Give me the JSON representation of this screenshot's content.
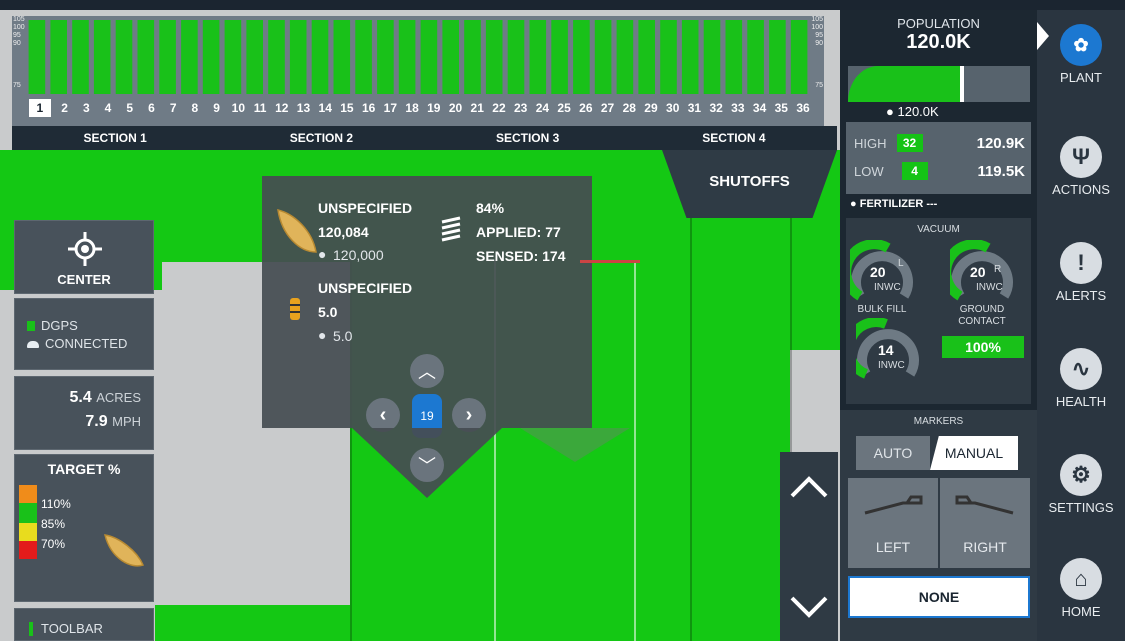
{
  "population_chart": {
    "scale_labels_left": [
      "105",
      "100",
      "95",
      "90",
      "75"
    ],
    "scale_labels_right": [
      "105",
      "100",
      "95",
      "90",
      "75"
    ],
    "rows": [
      "1",
      "2",
      "3",
      "4",
      "5",
      "6",
      "7",
      "8",
      "9",
      "10",
      "11",
      "12",
      "13",
      "14",
      "15",
      "16",
      "17",
      "18",
      "19",
      "20",
      "21",
      "22",
      "23",
      "24",
      "25",
      "26",
      "27",
      "28",
      "29",
      "30",
      "31",
      "32",
      "33",
      "34",
      "35",
      "36"
    ],
    "active_row": "1",
    "bar_color": "#19c119",
    "sections": [
      "SECTION 1",
      "SECTION 2",
      "SECTION 3",
      "SECTION 4"
    ]
  },
  "shutoffs_label": "SHUTOFFS",
  "left_panel": {
    "center_label": "CENTER",
    "gps_line1": "DGPS",
    "gps_line2": "CONNECTED",
    "acres_value": "5.4",
    "acres_unit": "ACRES",
    "speed_value": "7.9",
    "speed_unit": "MPH",
    "target_title": "TARGET %",
    "target_levels": [
      "110%",
      "85%",
      "70%"
    ],
    "target_colors": [
      "#f08c1a",
      "#19c119",
      "#e8dc1e",
      "#e31b1b"
    ],
    "toolbar_label": "TOOLBAR"
  },
  "popup": {
    "seed_name": "UNSPECIFIED",
    "seed_rate": "120,084",
    "seed_target": "120,000",
    "percent": "84%",
    "applied": "APPLIED: 77",
    "sensed": "SENSED: 174",
    "product2_name": "UNSPECIFIED",
    "product2_rate": "5.0",
    "product2_target": "5.0",
    "row_number": "19"
  },
  "right_panel": {
    "population_title": "POPULATION",
    "population_value": "120.0K",
    "population_target": "120.0K",
    "population_fill_fraction": 0.62,
    "high_label": "HIGH",
    "high_count": "32",
    "high_value": "120.9K",
    "low_label": "LOW",
    "low_count": "4",
    "low_value": "119.5K",
    "fertilizer_label": "FERTILIZER",
    "fertilizer_value": "---",
    "vacuum_title": "VACUUM",
    "vacuum_left_value": "20",
    "vacuum_left_side": "L",
    "vacuum_right_value": "20",
    "vacuum_right_side": "R",
    "vacuum_unit": "INWC",
    "bulk_fill_label": "BULK FILL",
    "bulk_fill_value": "14",
    "ground_contact_label_1": "GROUND",
    "ground_contact_label_2": "CONTACT",
    "ground_contact_value": "100%",
    "markers_title": "MARKERS",
    "marker_auto": "AUTO",
    "marker_manual": "MANUAL",
    "marker_left": "LEFT",
    "marker_right": "RIGHT",
    "marker_none": "NONE"
  },
  "nav": [
    {
      "label": "PLANT",
      "icon": "plant-icon"
    },
    {
      "label": "ACTIONS",
      "icon": "actions-icon"
    },
    {
      "label": "ALERTS",
      "icon": "alerts-icon"
    },
    {
      "label": "HEALTH",
      "icon": "health-icon"
    },
    {
      "label": "SETTINGS",
      "icon": "settings-icon"
    },
    {
      "label": "HOME",
      "icon": "home-icon"
    }
  ]
}
